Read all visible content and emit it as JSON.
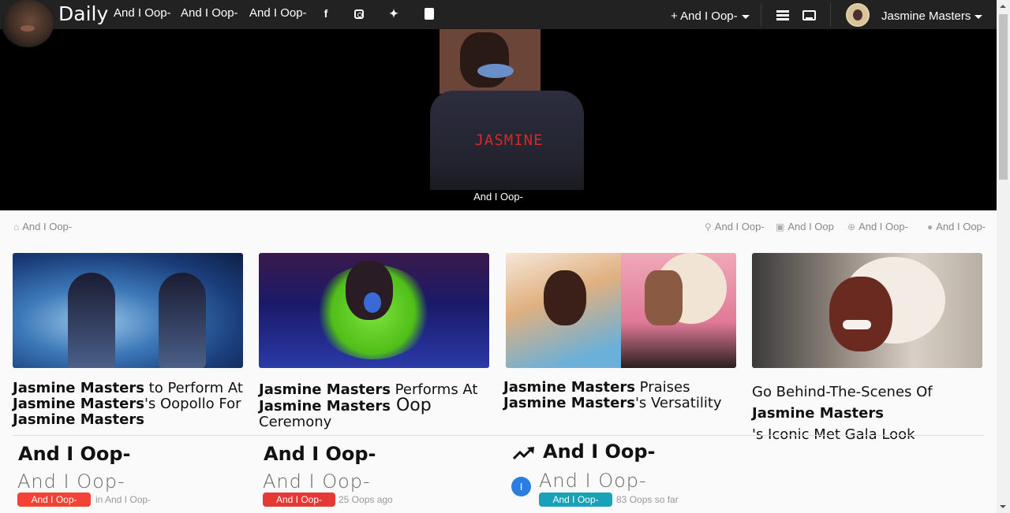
{
  "header": {
    "brand": "Daily",
    "nav_links": [
      "And I Oop-",
      "And I Oop-",
      "And I Oop-"
    ],
    "social_icons": [
      "facebook-icon",
      "instagram-icon",
      "twitter-icon",
      "youtube-icon"
    ],
    "add_label": "And I Oop-",
    "user_name": "Jasmine Masters"
  },
  "hero": {
    "shirt_text": "JASMINE",
    "caption": "And I Oop-"
  },
  "subnav": {
    "home": "And I Oop-",
    "search": "And I Oop-",
    "gallery": "And I Oop",
    "globe": "And I Oop-",
    "chat": "And I Oop-"
  },
  "cards": [
    {
      "name_a": "Jasmine Masters",
      "text_a": " to Perform At ",
      "name_b": "Jasmine Masters",
      "text_b": "'s Oopollo For ",
      "name_c": "Jasmine Masters",
      "text_c": ""
    },
    {
      "name_a": "Jasmine Masters",
      "text_a": " Performs At ",
      "name_b": "Jasmine Masters",
      "text_b": " Oop",
      "name_c": "",
      "text_c": "Ceremony"
    },
    {
      "name_a": "Jasmine Masters",
      "text_a": " Praises ",
      "name_b": "Jasmine Masters",
      "text_b": "'s Versatility",
      "name_c": "",
      "text_c": ""
    },
    {
      "name_a": "",
      "text_a": "Go Behind-The-Scenes Of ",
      "name_b": "Jasmine Masters",
      "text_b": "'s Iconic Met Gala Look",
      "name_c": "",
      "text_c": ""
    }
  ],
  "widgets": [
    {
      "heading": "And I Oop-",
      "sub": "And I Oop-",
      "badge": "And I Oop-",
      "meta": "in And I Oop-"
    },
    {
      "heading": "And I Oop-",
      "sub": "And I Oop-",
      "badge": "And I Oop-",
      "meta": "25 Oops ago"
    },
    {
      "heading": "And I Oop-",
      "sub": "And I Oop-",
      "badge": "And I Oop-",
      "meta": "83 Oops so far",
      "dot_letter": "I"
    }
  ],
  "colors": {
    "topbar": "#222222",
    "badge_red": "#e53935",
    "badge_teal": "#17a2b8",
    "dot_blue": "#2a7de1"
  }
}
